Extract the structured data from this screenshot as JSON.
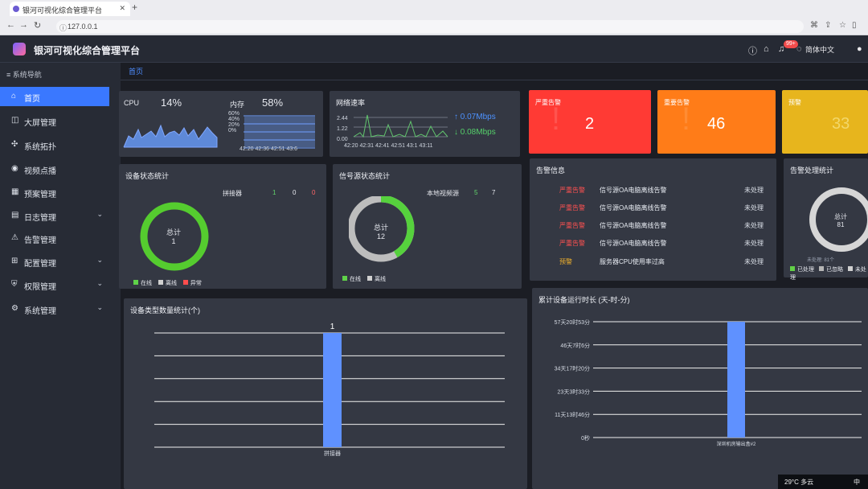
{
  "browser": {
    "tab_title": "银河可视化综合管理平台",
    "url": "127.0.0.1"
  },
  "app": {
    "title": "银河可视化综合管理平台",
    "notification_count": "99+",
    "language": "简体中文"
  },
  "sidebar": {
    "title": "系统导航",
    "items": [
      {
        "label": "首页",
        "icon": "home-icon"
      },
      {
        "label": "大屏管理",
        "icon": "layers-icon"
      },
      {
        "label": "系统拓扑",
        "icon": "topology-icon"
      },
      {
        "label": "视频点播",
        "icon": "video-icon"
      },
      {
        "label": "预案管理",
        "icon": "table-icon"
      },
      {
        "label": "日志管理",
        "icon": "log-icon"
      },
      {
        "label": "告警管理",
        "icon": "warning-icon"
      },
      {
        "label": "配置管理",
        "icon": "grid-icon"
      },
      {
        "label": "权限管理",
        "icon": "shield-icon"
      },
      {
        "label": "系统管理",
        "icon": "gear-icon"
      }
    ]
  },
  "breadcrumb": {
    "tab": "首页"
  },
  "metrics": {
    "cpu_label": "CPU",
    "cpu_value": "14%",
    "memory_label": "内存",
    "memory_value": "58%",
    "memory_ticks": [
      "60%",
      "40%",
      "20%",
      "0%"
    ],
    "cpu_times": [
      "42:20",
      "42:36",
      "42:51",
      "43:6"
    ],
    "network_title": "网络速率",
    "network_up": "0.07Mbps",
    "network_down": "0.08Mbps",
    "network_y_ticks": [
      "2.44",
      "1.22",
      "0.00"
    ],
    "network_times": [
      "42:20",
      "42:31",
      "42:41",
      "42:51",
      "43:1",
      "43:11"
    ]
  },
  "alarms": {
    "critical_label": "严重告警",
    "critical_value": "2",
    "important_label": "重要告警",
    "important_value": "46",
    "warning_label": "预警",
    "warning_value": "33"
  },
  "device_stats": {
    "title": "设备状态统计",
    "total_label": "总计",
    "total_value": "1",
    "row_name": "拼接器",
    "row_values": [
      "1",
      "0",
      "0"
    ],
    "legend": [
      "在线",
      "离线",
      "异常"
    ]
  },
  "signal_stats": {
    "title": "信号源状态统计",
    "total_label": "总计",
    "total_value": "12",
    "row_name": "本地视频源",
    "row_values": [
      "5",
      "7"
    ],
    "legend": [
      "在线",
      "离线"
    ]
  },
  "alarm_info": {
    "title": "告警信息",
    "rows": [
      {
        "level": "严重告警",
        "message": "信号源OA电脑离线告警",
        "state": "未处理"
      },
      {
        "level": "严重告警",
        "message": "信号源OA电脑离线告警",
        "state": "未处理"
      },
      {
        "level": "严重告警",
        "message": "信号源OA电脑离线告警",
        "state": "未处理"
      },
      {
        "level": "严重告警",
        "message": "信号源OA电脑离线告警",
        "state": "未处理"
      },
      {
        "level": "预警",
        "message": "服务器CPU使用率过高",
        "state": "未处理"
      }
    ]
  },
  "alarm_processing": {
    "title": "告警处理统计",
    "total_label": "总计",
    "total_value": "81",
    "overlay_text": "未处理: 81个",
    "legend": [
      "已处理",
      "已忽略",
      "未处理"
    ]
  },
  "chart_data": [
    {
      "type": "bar",
      "title": "设备类型数量统计(个)",
      "categories": [
        "拼接器"
      ],
      "values": [
        1
      ],
      "ylim": [
        0,
        1
      ],
      "grid": true
    },
    {
      "type": "bar",
      "title": "累计设备运行时长 (天-时-分)",
      "categories": [
        "深圳机房输出盒#2"
      ],
      "values": [
        "57天20时53分"
      ],
      "yticks": [
        "0秒",
        "11天13时46分",
        "23天3时33分",
        "34天17时20分",
        "46天7时6分",
        "57天20时53分"
      ],
      "grid": true
    }
  ],
  "taskbar": {
    "weather": "29°C 多云",
    "ime": "中"
  }
}
